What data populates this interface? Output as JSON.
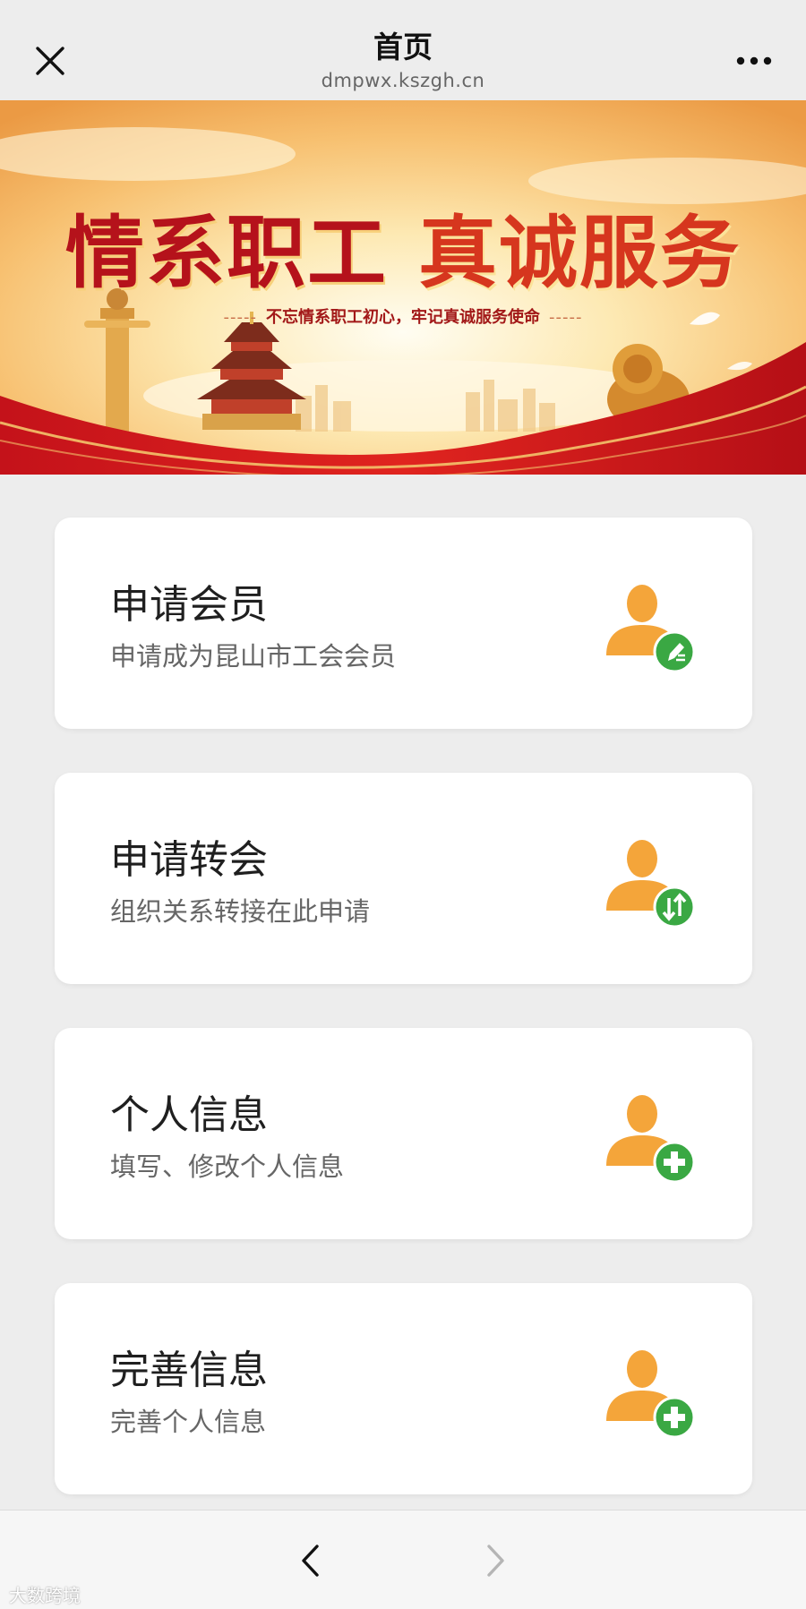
{
  "header": {
    "title": "首页",
    "url": "dmpwx.kszgh.cn",
    "close_icon": "close-icon",
    "more_icon": "more-horizontal-icon"
  },
  "banner": {
    "title_part1": "情系职工",
    "title_part2": "真诚服务",
    "subtitle": "不忘情系职工初心，牢记真诚服务使命",
    "subtitle_dash": "-----"
  },
  "cards": [
    {
      "title": "申请会员",
      "desc": "申请成为昆山市工会会员",
      "icon": "user-edit-icon"
    },
    {
      "title": "申请转会",
      "desc": "组织关系转接在此申请",
      "icon": "user-transfer-icon"
    },
    {
      "title": "个人信息",
      "desc": "填写、修改个人信息",
      "icon": "user-add-icon"
    },
    {
      "title": "完善信息",
      "desc": "完善个人信息",
      "icon": "user-add-icon"
    }
  ],
  "footer": {
    "back_icon": "chevron-left-icon",
    "forward_icon": "chevron-right-icon"
  },
  "watermark": "大数跨境",
  "colors": {
    "page_bg": "#ededed",
    "person_orange": "#f4a53a",
    "badge_green": "#3aa843",
    "banner_red": "#c8161d"
  }
}
